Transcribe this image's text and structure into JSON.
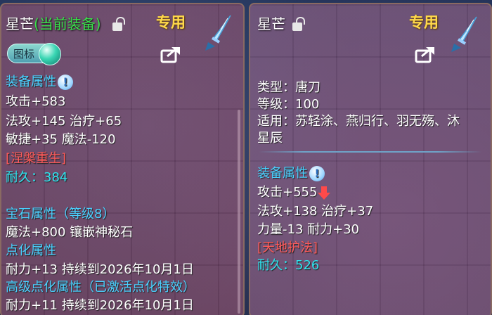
{
  "left_panel": {
    "item_name": "星芒",
    "equipped_tag": "(当前装备)",
    "special_label": "专用",
    "marker_label": "图标",
    "equip_attr_heading": "装备属性",
    "attrs": [
      "攻击+583",
      "法攻+145 治疗+65",
      "敏捷+35 魔法-120"
    ],
    "special_effect": "[涅槃重生]",
    "durability": "耐久：384",
    "gem_heading": "宝石属性（等级8）",
    "gem_line": "魔法+800 镶嵌神秘石",
    "refine_heading": "点化属性",
    "refine_line": "耐力+13 持续到2026年10月1日",
    "adv_refine_heading": "高级点化属性（已激活点化特效）",
    "adv_refine_line": "耐力+11 持续到2026年10月1日"
  },
  "right_panel": {
    "item_name": "星芒",
    "special_label": "专用",
    "type_line": "类型：唐刀",
    "level_line": "等级：100",
    "applicable_line1": "适用：苏轻涂、燕归行、羽无殇、沐",
    "applicable_line2": "星辰",
    "equip_attr_heading": "装备属性",
    "attrs": [
      "攻击+555",
      "法攻+138 治疗+37",
      "力量-13 耐力+30"
    ],
    "special_effect": "[天地护法]",
    "durability": "耐久：526"
  },
  "colors": {
    "heading_blue": "#4ad0ff",
    "effect_red": "#ff5b5b",
    "durability_cyan": "#2fe3ef",
    "special_gold": "#ffd94a",
    "equipped_green": "#39e24a"
  }
}
